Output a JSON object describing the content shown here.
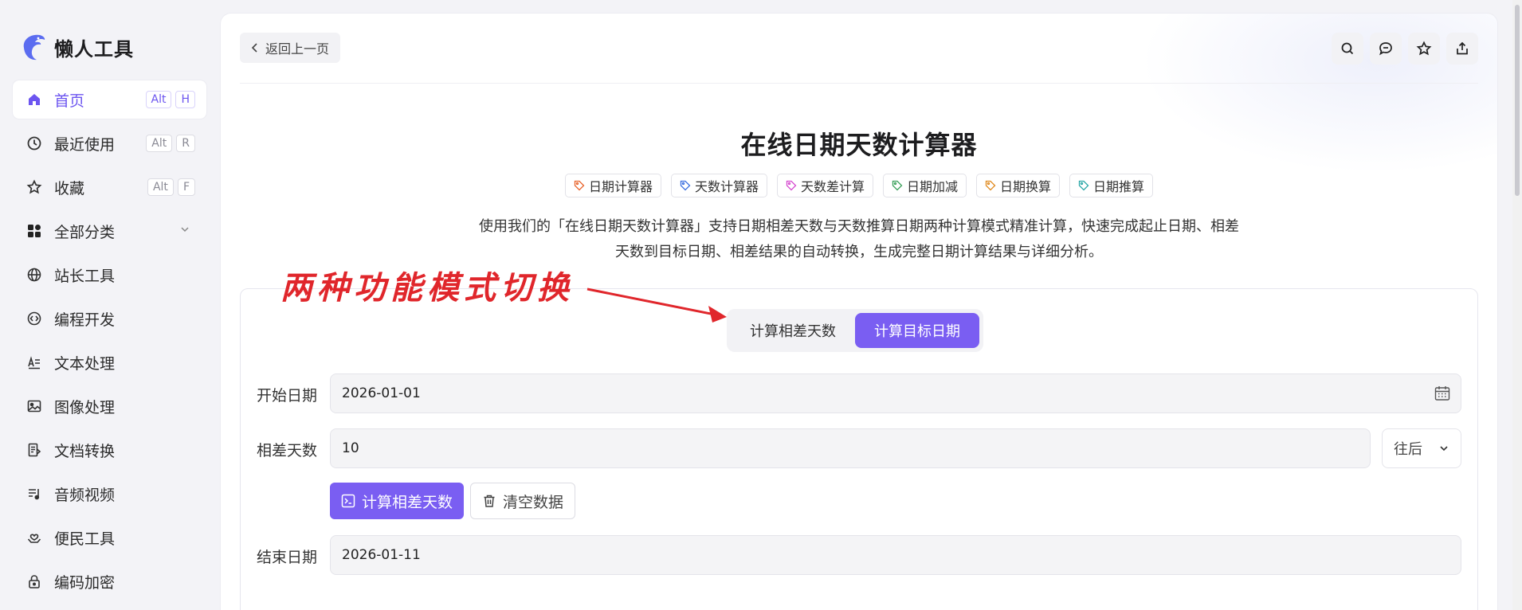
{
  "app": {
    "name": "懒人工具"
  },
  "sidebar": {
    "items": [
      {
        "label": "首页",
        "icon": "home-icon",
        "keys": [
          "Alt",
          "H"
        ],
        "active": true
      },
      {
        "label": "最近使用",
        "icon": "history-icon",
        "keys": [
          "Alt",
          "R"
        ]
      },
      {
        "label": "收藏",
        "icon": "star-icon",
        "keys": [
          "Alt",
          "F"
        ]
      },
      {
        "label": "全部分类",
        "icon": "grid-icon",
        "expandable": true
      },
      {
        "label": "站长工具",
        "icon": "globe-icon"
      },
      {
        "label": "编程开发",
        "icon": "code-icon"
      },
      {
        "label": "文本处理",
        "icon": "text-icon"
      },
      {
        "label": "图像处理",
        "icon": "image-icon"
      },
      {
        "label": "文档转换",
        "icon": "document-icon"
      },
      {
        "label": "音频视频",
        "icon": "music-icon"
      },
      {
        "label": "便民工具",
        "icon": "hand-heart-icon"
      },
      {
        "label": "编码加密",
        "icon": "lock-icon"
      }
    ]
  },
  "topbar": {
    "back_label": "返回上一页",
    "actions": [
      "search-icon",
      "comment-icon",
      "star-icon",
      "share-icon"
    ]
  },
  "page": {
    "title": "在线日期天数计算器",
    "tags": [
      {
        "label": "日期计算器",
        "color": "#e8632b"
      },
      {
        "label": "天数计算器",
        "color": "#3b6fe0"
      },
      {
        "label": "天数差计算",
        "color": "#d64ad0"
      },
      {
        "label": "日期加减",
        "color": "#3aa05a"
      },
      {
        "label": "日期换算",
        "color": "#e08a1e"
      },
      {
        "label": "日期推算",
        "color": "#2aa7a7"
      }
    ],
    "description_line1": "使用我们的「在线日期天数计算器」支持日期相差天数与天数推算日期两种计算模式精准计算，快速完成起止日期、相差",
    "description_line2": "天数到目标日期、相差结果的自动转换，生成完整日期计算结果与详细分析。"
  },
  "annotation": {
    "text": "两种功能模式切换",
    "color": "#e0262b"
  },
  "calculator": {
    "modes": [
      {
        "label": "计算相差天数",
        "active": false
      },
      {
        "label": "计算目标日期",
        "active": true
      }
    ],
    "start_label": "开始日期",
    "start_value": "2026-01-01",
    "diff_label": "相差天数",
    "diff_value": "10",
    "direction_value": "往后",
    "calc_button": "计算相差天数",
    "clear_button": "清空数据",
    "end_label": "结束日期",
    "end_value": "2026-01-11"
  },
  "colors": {
    "accent": "#7a5ef2",
    "active_nav": "#6c55f0"
  }
}
